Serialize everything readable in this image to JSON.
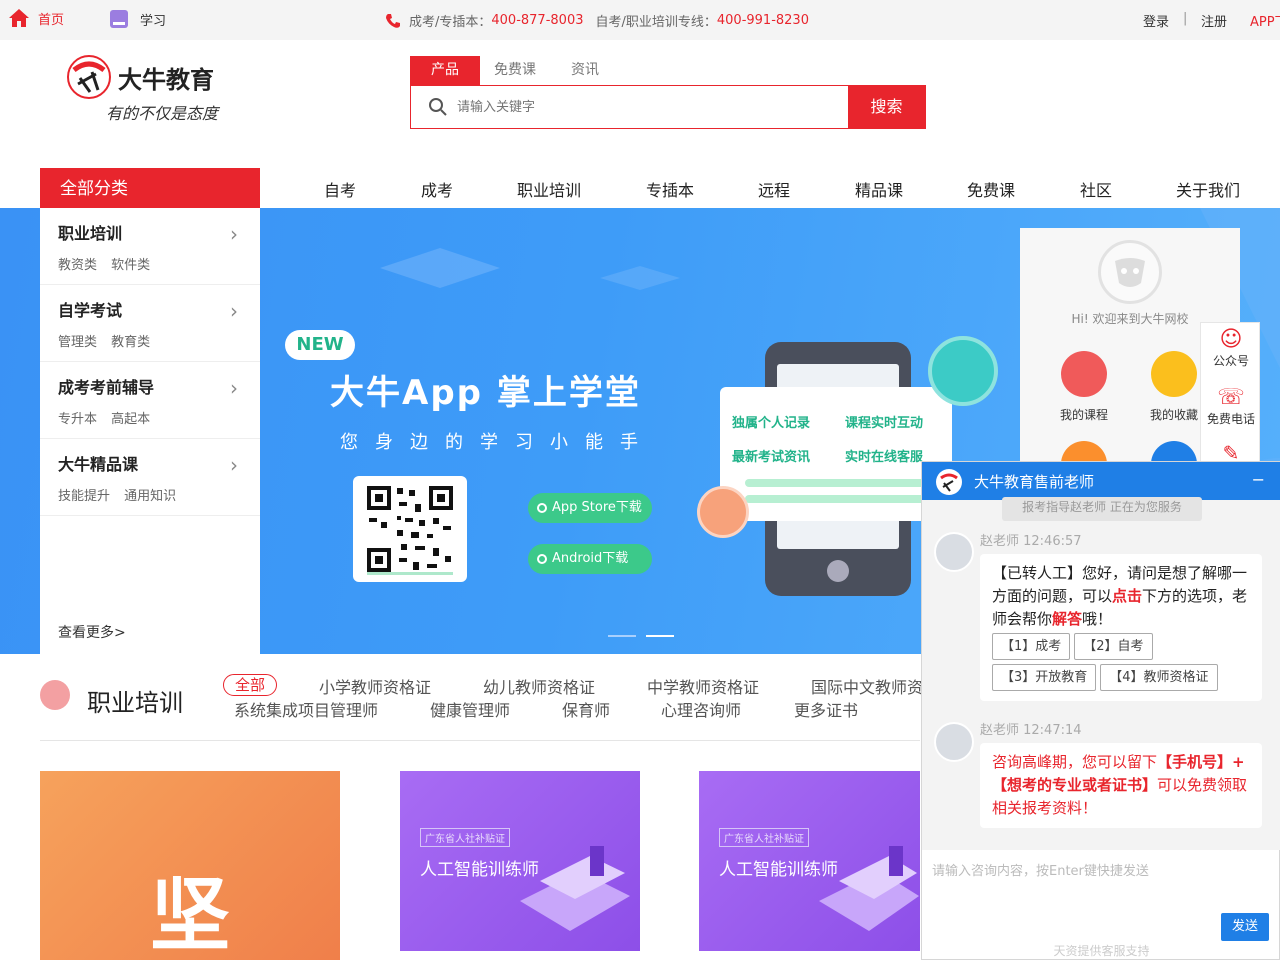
{
  "topbar": {
    "home": "首页",
    "study": "学习",
    "hotline_prefix": "成考/专插本：",
    "hotline_1": "400-877-8003",
    "hotline_mid": "自考/职业培训专线：",
    "hotline_2": "400-991-8230",
    "login": "登录",
    "separator": "|",
    "register": "注册",
    "app": "APP下"
  },
  "logo": {
    "brand": "大牛教育",
    "slogan": "有的不仅是态度"
  },
  "search": {
    "tabs": [
      "产品",
      "免费课",
      "资讯"
    ],
    "placeholder": "请输入关键字",
    "button": "搜索"
  },
  "nav": {
    "all": "全部分类",
    "items": [
      "自考",
      "成考",
      "职业培训",
      "专插本",
      "远程",
      "精品课",
      "免费课",
      "社区",
      "关于我们"
    ]
  },
  "categories": [
    {
      "title": "职业培训",
      "sub": "教资类 软件类"
    },
    {
      "title": "自学考试",
      "sub": "管理类 教育类"
    },
    {
      "title": "成考考前辅导",
      "sub": "专升本 高起本"
    },
    {
      "title": "大牛精品课",
      "sub": "技能提升 通用知识"
    }
  ],
  "see_more": "查看更多>",
  "banner": {
    "badge": "NEW",
    "title": "大牛App  掌上学堂",
    "subtitle": "您身边的学习小能手",
    "appstore": "App Store下载",
    "android": "Android下载",
    "feature_1": "独属个人记录",
    "feature_2": "课程实时互动",
    "feature_3": "最新考试资讯",
    "feature_4": "实时在线客服"
  },
  "userpanel": {
    "greeting": "Hi! 欢迎来到大牛网校",
    "my_courses": "我的课程",
    "my_favorites": "我的收藏"
  },
  "floatbar": {
    "wechat": "公众号",
    "free_call": "免费电话"
  },
  "training": {
    "title": "职业培训",
    "all": "全部",
    "row1": [
      "小学教师资格证",
      "幼儿教师资格证",
      "中学教师资格证",
      "国际中文教师资"
    ],
    "row2": [
      "系统集成项目管理师",
      "健康管理师",
      "保育师",
      "心理咨询师",
      "更多证书"
    ]
  },
  "thumbs": {
    "t1_big": "坚",
    "t2_tag": "广东省人社补贴证",
    "t2_title": "人工智能训练师",
    "t3_tag": "广东省人社补贴证",
    "t3_title": "人工智能训练师"
  },
  "chat": {
    "title": "大牛教育售前老师",
    "minimize": "−",
    "system": "报考指导赵老师 正在为您服务",
    "msg1_name": "赵老师 12:46:57",
    "msg1_a": "【已转人工】您好，请问是想了解哪一方面的问题，可以",
    "msg1_b": "点击",
    "msg1_c": "下方的选项，老师会帮你",
    "msg1_d": "解答",
    "msg1_e": "哦！",
    "options": [
      "【1】成考",
      "【2】自考",
      "【3】开放教育",
      "【4】教师资格证"
    ],
    "msg2_name": "赵老师 12:47:14",
    "msg2_a": "咨询高峰期，您可以留下",
    "msg2_b": "【手机号】+【想考的专业或者证书】",
    "msg2_c": "可以免费领取相关报考资料！",
    "input_placeholder": "请输入咨询内容，按Enter键快捷发送",
    "send": "发送",
    "footer": "天资提供客服支持"
  },
  "colors": {
    "brand_red": "#e8252d",
    "chat_blue": "#1f7fe6",
    "banner_blue": "#3e9cf8",
    "green": "#3cc98a"
  }
}
